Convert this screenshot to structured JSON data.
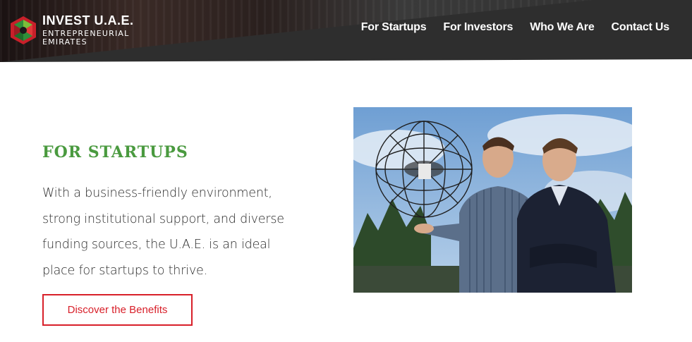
{
  "header": {
    "logo": {
      "title": "INVEST U.A.E.",
      "subtitle_line1": "ENTREPRENEURIAL",
      "subtitle_line2": "EMIRATES"
    },
    "nav": [
      {
        "label": "For Startups"
      },
      {
        "label": "For Investors"
      },
      {
        "label": "Who We Are"
      },
      {
        "label": "Contact Us"
      }
    ]
  },
  "main": {
    "heading": "FOR STARTUPS",
    "body": "With a business-friendly environment, strong institutional support, and diverse funding sources, the U.A.E. is an ideal place for startups to thrive.",
    "cta_label": "Discover the Benefits",
    "photo_icon": "photo-two-men-with-drone"
  },
  "colors": {
    "header_bg": "#2e2e2e",
    "heading_green": "#4a9a3f",
    "accent_red": "#d8202a",
    "text_dark": "#2b2b2b"
  }
}
